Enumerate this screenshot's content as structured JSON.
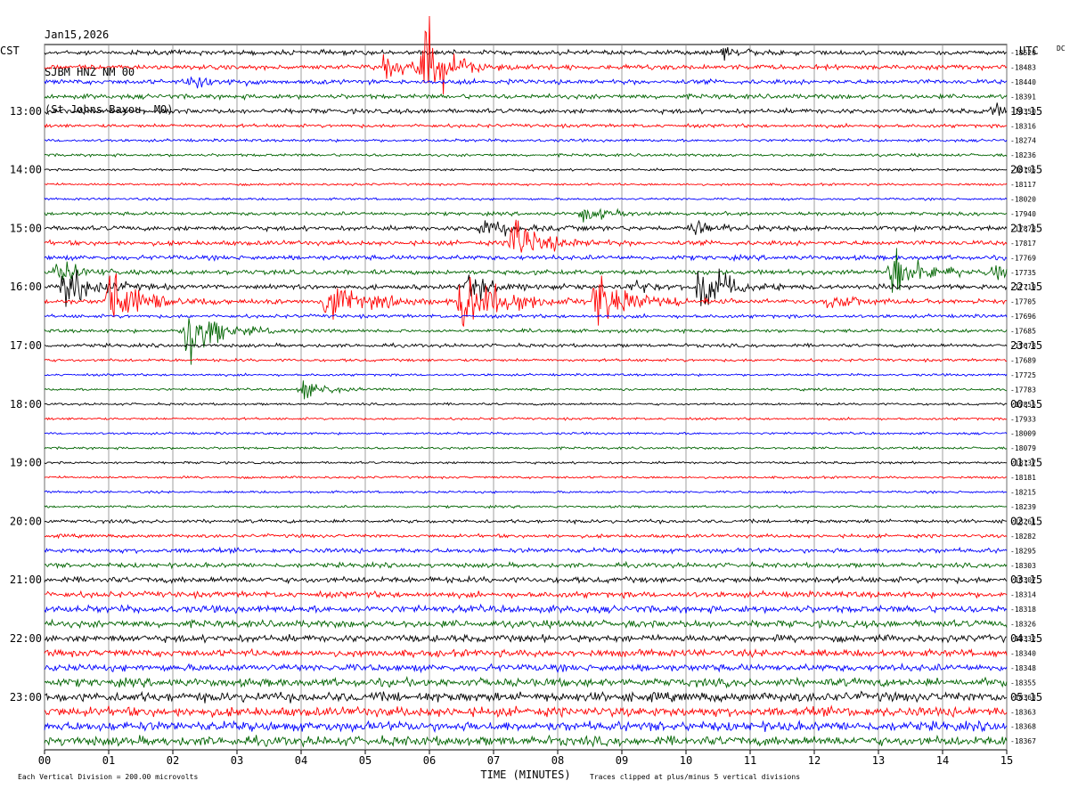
{
  "header": {
    "date": "Jan15,2026",
    "station": "SJBM HNZ NM 00",
    "location": "(St Johns Bayou, MO)"
  },
  "labels": {
    "left_tz": "CST",
    "right_tz": "UTC",
    "dc": "DC",
    "xlabel": "TIME (MINUTES)",
    "scale_note": "Each Vertical Division =  200.00 microvolts",
    "clip_note": "Traces clipped at plus/minus 5 vertical divisions"
  },
  "colors": {
    "trace": [
      "#000000",
      "#ff0000",
      "#0000ff",
      "#006400"
    ],
    "grid": "#888888"
  },
  "chart_data": {
    "type": "helicorder",
    "x_ticks": [
      "00",
      "01",
      "02",
      "03",
      "04",
      "05",
      "06",
      "07",
      "08",
      "09",
      "10",
      "11",
      "12",
      "13",
      "14",
      "15"
    ],
    "xlim": [
      0,
      15
    ],
    "left_hours": [
      "13:00",
      "14:00",
      "15:00",
      "16:00",
      "17:00",
      "18:00",
      "19:00",
      "20:00",
      "21:00",
      "22:00",
      "23:00"
    ],
    "right_hours": [
      "19:15",
      "20:15",
      "21:15",
      "22:15",
      "23:15",
      "00:15",
      "01:15",
      "02:15",
      "03:15",
      "04:15",
      "05:15"
    ],
    "dc_offsets": [
      "-18520",
      "-18483",
      "-18440",
      "-18391",
      "-18350",
      "-18316",
      "-18274",
      "-18236",
      "-18195",
      "-18117",
      "-18020",
      "-17940",
      "-17878",
      "-17817",
      "-17769",
      "-17735",
      "-17719",
      "-17705",
      "-17696",
      "-17685",
      "-17678",
      "-17689",
      "-17725",
      "-17783",
      "-17855",
      "-17933",
      "-18009",
      "-18079",
      "-18137",
      "-18181",
      "-18215",
      "-18239",
      "-18261",
      "-18282",
      "-18295",
      "-18303",
      "-18307",
      "-18314",
      "-18318",
      "-18326",
      "-18332",
      "-18340",
      "-18348",
      "-18355",
      "-18363",
      "-18363",
      "-18368",
      "-18367"
    ],
    "noise_level": [
      2,
      2,
      2,
      2,
      2,
      1.5,
      1.2,
      1.2,
      1,
      1,
      1,
      1.5,
      2,
      2,
      2,
      2,
      2,
      2,
      1.5,
      1.5,
      1.5,
      1.2,
      1,
      1,
      1,
      1,
      1,
      1,
      1,
      1,
      1,
      1,
      1.5,
      1.5,
      2,
      2,
      2.5,
      2.5,
      3,
      3,
      3,
      3,
      3,
      3.5,
      4,
      4,
      4,
      4
    ],
    "events": [
      {
        "row": 0,
        "minute": 10.6,
        "amp": 8,
        "dur": 0.4
      },
      {
        "row": 1,
        "minute": 5.3,
        "amp": 10,
        "dur": 1.2
      },
      {
        "row": 1,
        "minute": 5.9,
        "amp": 55,
        "dur": 0.6
      },
      {
        "row": 2,
        "minute": 2.3,
        "amp": 12,
        "dur": 0.6
      },
      {
        "row": 4,
        "minute": 14.8,
        "amp": 10,
        "dur": 0.3
      },
      {
        "row": 11,
        "minute": 8.4,
        "amp": 10,
        "dur": 0.6
      },
      {
        "row": 12,
        "minute": 6.8,
        "amp": 12,
        "dur": 0.8
      },
      {
        "row": 12,
        "minute": 10.1,
        "amp": 10,
        "dur": 0.6
      },
      {
        "row": 13,
        "minute": 7.3,
        "amp": 30,
        "dur": 0.8
      },
      {
        "row": 15,
        "minute": 0.2,
        "amp": 14,
        "dur": 0.6
      },
      {
        "row": 15,
        "minute": 13.2,
        "amp": 40,
        "dur": 0.7
      },
      {
        "row": 15,
        "minute": 14.8,
        "amp": 14,
        "dur": 0.4
      },
      {
        "row": 16,
        "minute": 0.3,
        "amp": 30,
        "dur": 0.8
      },
      {
        "row": 16,
        "minute": 6.6,
        "amp": 14,
        "dur": 0.8
      },
      {
        "row": 16,
        "minute": 9.2,
        "amp": 10,
        "dur": 0.5
      },
      {
        "row": 16,
        "minute": 10.2,
        "amp": 35,
        "dur": 0.7
      },
      {
        "row": 17,
        "minute": 1.0,
        "amp": 40,
        "dur": 0.9
      },
      {
        "row": 17,
        "minute": 4.4,
        "amp": 26,
        "dur": 1.0
      },
      {
        "row": 17,
        "minute": 6.5,
        "amp": 42,
        "dur": 1.0
      },
      {
        "row": 17,
        "minute": 8.6,
        "amp": 38,
        "dur": 0.9
      },
      {
        "row": 17,
        "minute": 12.2,
        "amp": 12,
        "dur": 0.6
      },
      {
        "row": 19,
        "minute": 2.2,
        "amp": 55,
        "dur": 0.7
      },
      {
        "row": 23,
        "minute": 4.0,
        "amp": 10,
        "dur": 0.8
      }
    ]
  }
}
